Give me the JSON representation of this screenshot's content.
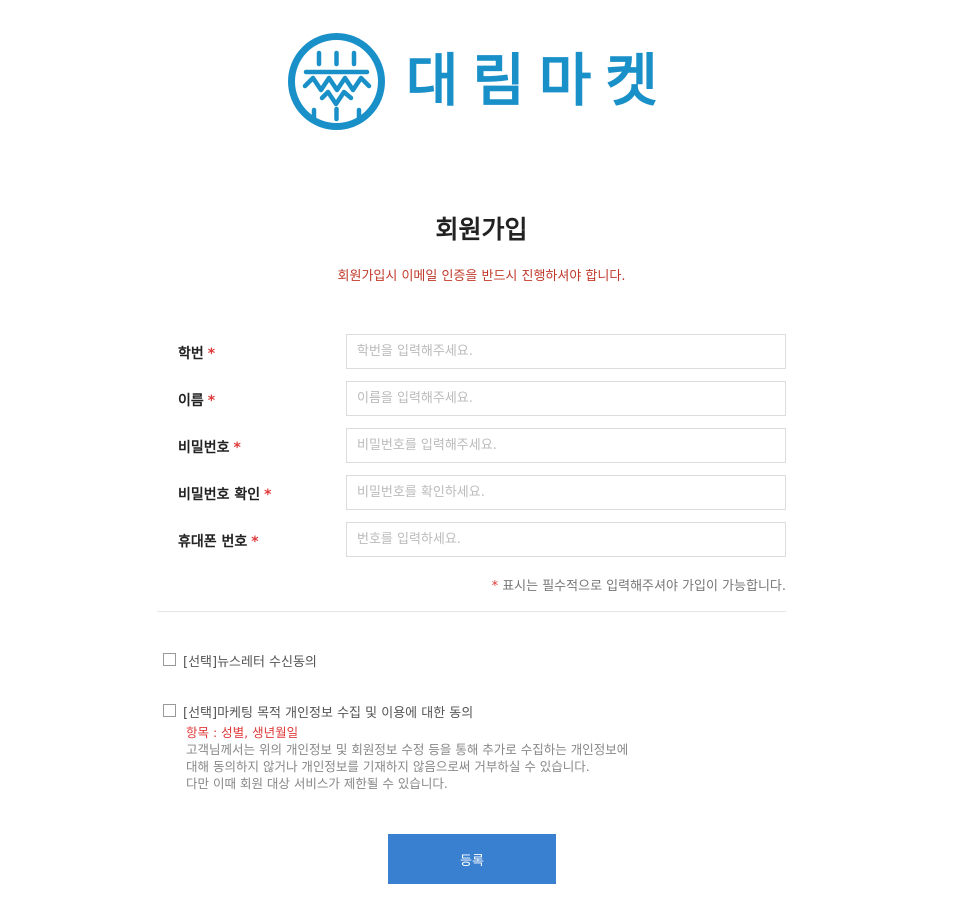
{
  "brand": {
    "name": "대림마켓",
    "color": "#1a90c8"
  },
  "page": {
    "title": "회원가입",
    "notice": "회원가입시 이메일 인증을 반드시 진행하셔야 합니다."
  },
  "form": {
    "required_mark": "*",
    "fields": [
      {
        "label": "학번",
        "placeholder": "학번을 입력해주세요."
      },
      {
        "label": "이름",
        "placeholder": "이름을 입력해주세요."
      },
      {
        "label": "비밀번호",
        "placeholder": "비밀번호를 입력해주세요."
      },
      {
        "label": "비밀번호 확인",
        "placeholder": "비밀번호를 확인하세요."
      },
      {
        "label": "휴대폰 번호",
        "placeholder": "번호를 입력하세요."
      }
    ],
    "hint_star": "*",
    "hint_text": " 표시는 필수적으로 입력해주셔야 가입이 가능합니다."
  },
  "consents": {
    "newsletter_label": "[선택]뉴스레터 수신동의",
    "marketing_label": "[선택]마케팅 목적 개인정보 수집 및 이용에 대한 동의",
    "items": "항목 : 성별, 생년월일",
    "desc_1": "고객님께서는 위의 개인정보 및 회원정보 수정 등을 통해 추가로 수집하는 개인정보에",
    "desc_2": "대해 동의하지 않거나 개인정보를 기재하지 않음으로써 거부하실 수 있습니다.",
    "desc_3": "다만 이때 회원 대상 서비스가 제한될 수 있습니다."
  },
  "submit_label": "등록",
  "colors": {
    "accent": "#3a80d0",
    "required": "#e03a3a",
    "notice": "#c0392b"
  }
}
